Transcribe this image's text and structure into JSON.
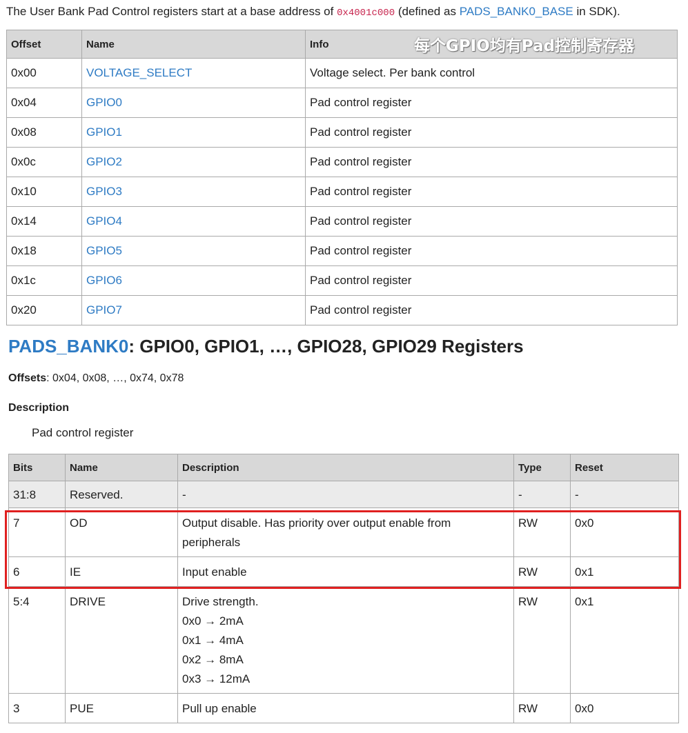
{
  "intro": {
    "prefix": "The User Bank Pad Control registers start at a base address of",
    "base_address": "0x4001c000",
    "mid": "(defined as",
    "sdk_name": "PADS_BANK0_BASE",
    "suffix": "in SDK)."
  },
  "watermark": "每个GPIO均有Pad控制寄存器",
  "table1": {
    "headers": [
      "Offset",
      "Name",
      "Info"
    ],
    "rows": [
      {
        "offset": "0x00",
        "name": "VOLTAGE_SELECT",
        "info": "Voltage select. Per bank control"
      },
      {
        "offset": "0x04",
        "name": "GPIO0",
        "info": "Pad control register"
      },
      {
        "offset": "0x08",
        "name": "GPIO1",
        "info": "Pad control register"
      },
      {
        "offset": "0x0c",
        "name": "GPIO2",
        "info": "Pad control register"
      },
      {
        "offset": "0x10",
        "name": "GPIO3",
        "info": "Pad control register"
      },
      {
        "offset": "0x14",
        "name": "GPIO4",
        "info": "Pad control register"
      },
      {
        "offset": "0x18",
        "name": "GPIO5",
        "info": "Pad control register"
      },
      {
        "offset": "0x1c",
        "name": "GPIO6",
        "info": "Pad control register"
      },
      {
        "offset": "0x20",
        "name": "GPIO7",
        "info": "Pad control register"
      },
      {
        "offset": "",
        "name": "",
        "info": ""
      }
    ]
  },
  "section": {
    "title_link": "PADS_BANK0",
    "title_rest": ": GPIO0, GPIO1, …, GPIO28, GPIO29 Registers",
    "offsets_label": "Offsets",
    "offsets_value": ": 0x04, 0x08, …, 0x74, 0x78",
    "description_heading": "Description",
    "description_text": "Pad control register"
  },
  "table2": {
    "headers": [
      "Bits",
      "Name",
      "Description",
      "Type",
      "Reset"
    ],
    "rows": [
      {
        "bits": "31:8",
        "name": "Reserved.",
        "desc": [
          "-"
        ],
        "type": "-",
        "reset": "-",
        "reserved": true
      },
      {
        "bits": "7",
        "name": "OD",
        "desc": [
          "Output disable. Has priority over output enable from peripherals"
        ],
        "type": "RW",
        "reset": "0x0"
      },
      {
        "bits": "6",
        "name": "IE",
        "desc": [
          "Input enable"
        ],
        "type": "RW",
        "reset": "0x1"
      },
      {
        "bits": "5:4",
        "name": "DRIVE",
        "desc": [
          "Drive strength.",
          "0x0 → 2mA",
          "0x1 → 4mA",
          "0x2 → 8mA",
          "0x3 → 12mA"
        ],
        "type": "RW",
        "reset": "0x1"
      },
      {
        "bits": "3",
        "name": "PUE",
        "desc": [
          "Pull up enable"
        ],
        "type": "RW",
        "reset": "0x0"
      }
    ]
  },
  "colors": {
    "link": "#2e7bc4",
    "code": "#c7254e",
    "highlight": "#e02020",
    "header_bg": "#d8d8d8"
  }
}
